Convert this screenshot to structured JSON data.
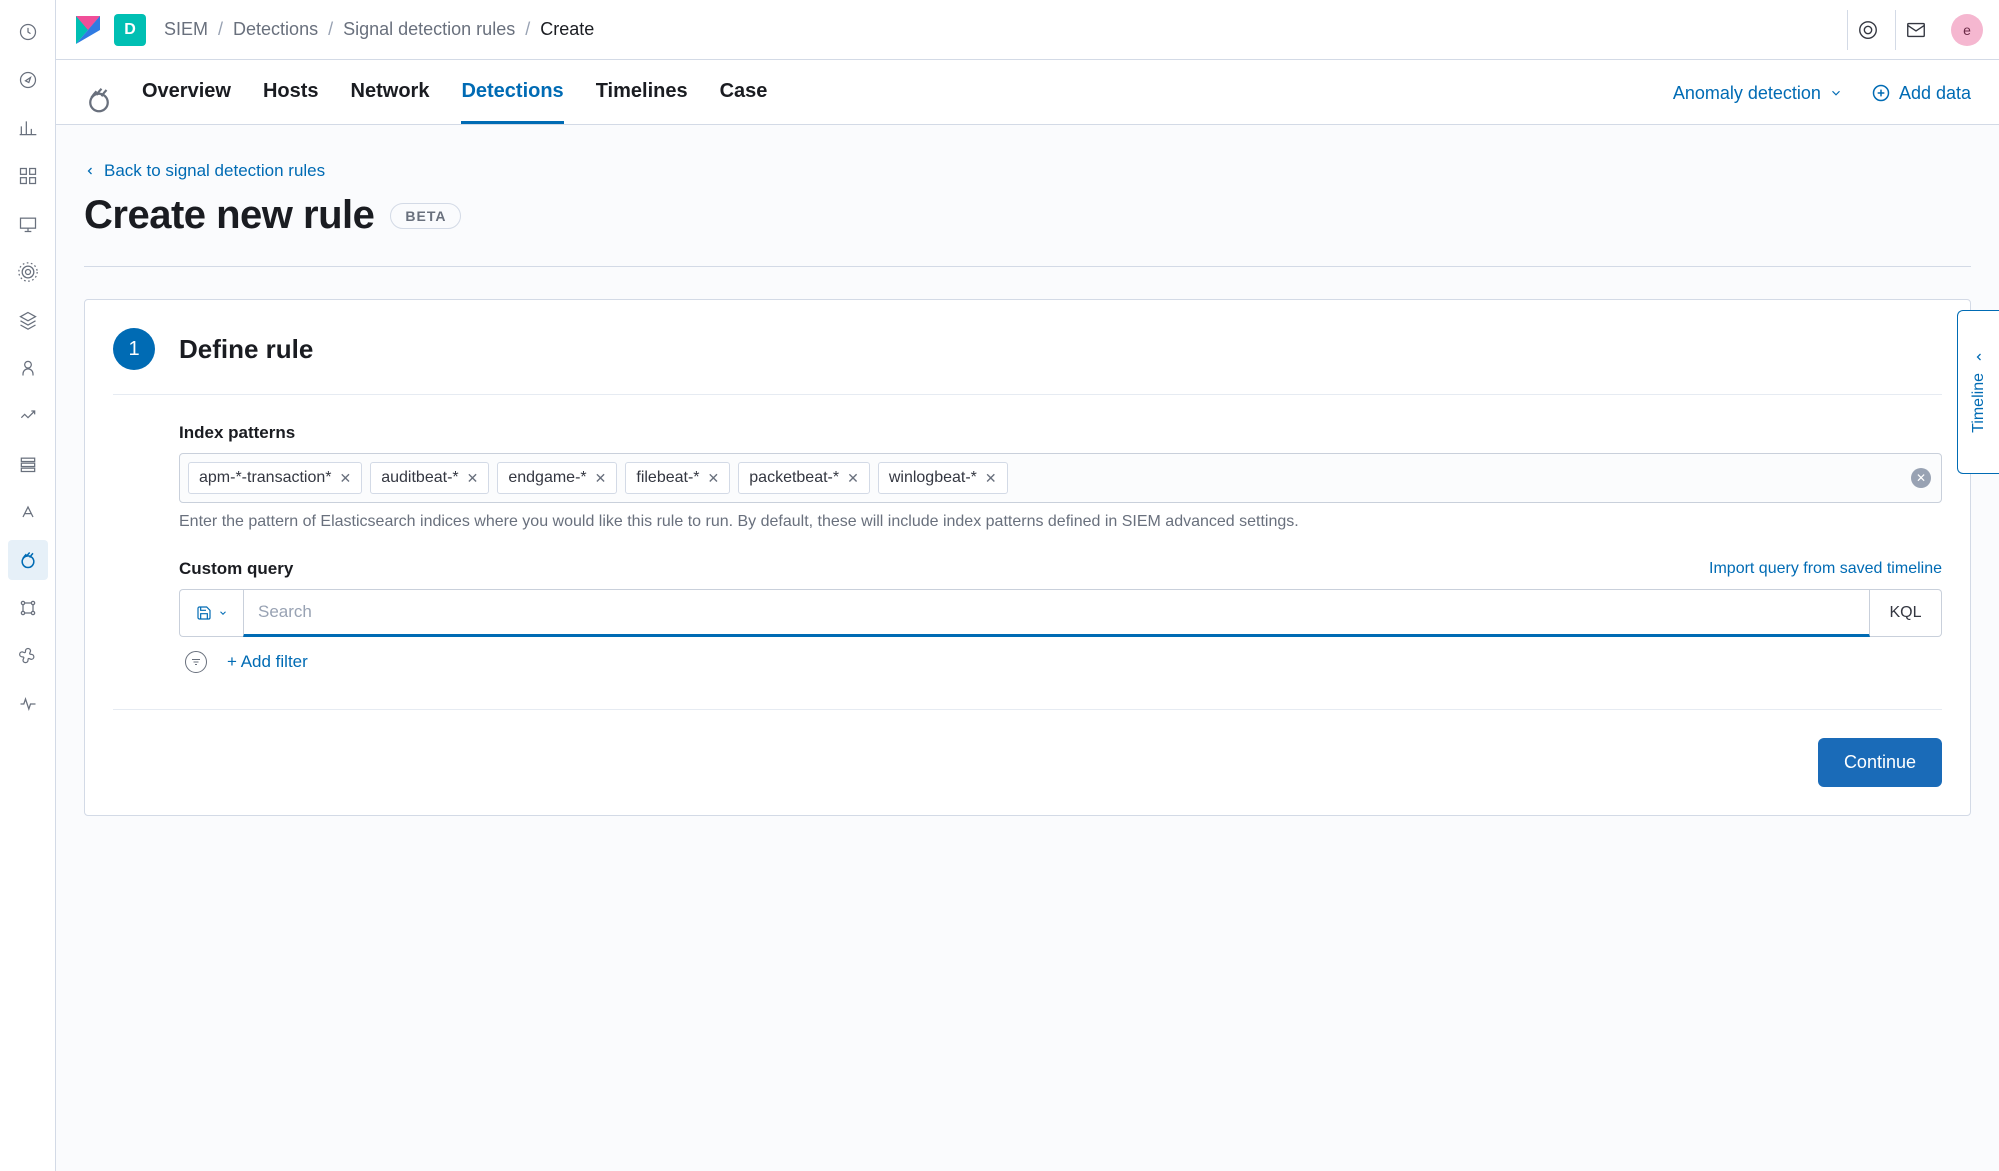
{
  "topbar": {
    "app_badge": "D",
    "breadcrumb": [
      "SIEM",
      "Detections",
      "Signal detection rules",
      "Create"
    ],
    "avatar": "e"
  },
  "nav": {
    "tabs": [
      "Overview",
      "Hosts",
      "Network",
      "Detections",
      "Timelines",
      "Case"
    ],
    "active_index": 3,
    "anomaly": "Anomaly detection",
    "add_data": "Add data"
  },
  "page": {
    "back": "Back to signal detection rules",
    "title": "Create new rule",
    "badge": "BETA"
  },
  "step": {
    "number": "1",
    "title": "Define rule"
  },
  "form": {
    "index_label": "Index patterns",
    "patterns": [
      "apm-*-transaction*",
      "auditbeat-*",
      "endgame-*",
      "filebeat-*",
      "packetbeat-*",
      "winlogbeat-*"
    ],
    "index_help": "Enter the pattern of Elasticsearch indices where you would like this rule to run. By default, these will include index patterns defined in SIEM advanced settings.",
    "query_label": "Custom query",
    "import_link": "Import query from saved timeline",
    "search_placeholder": "Search",
    "kql": "KQL",
    "add_filter": "+ Add filter",
    "continue": "Continue"
  },
  "timeline_flyout": "Timeline"
}
